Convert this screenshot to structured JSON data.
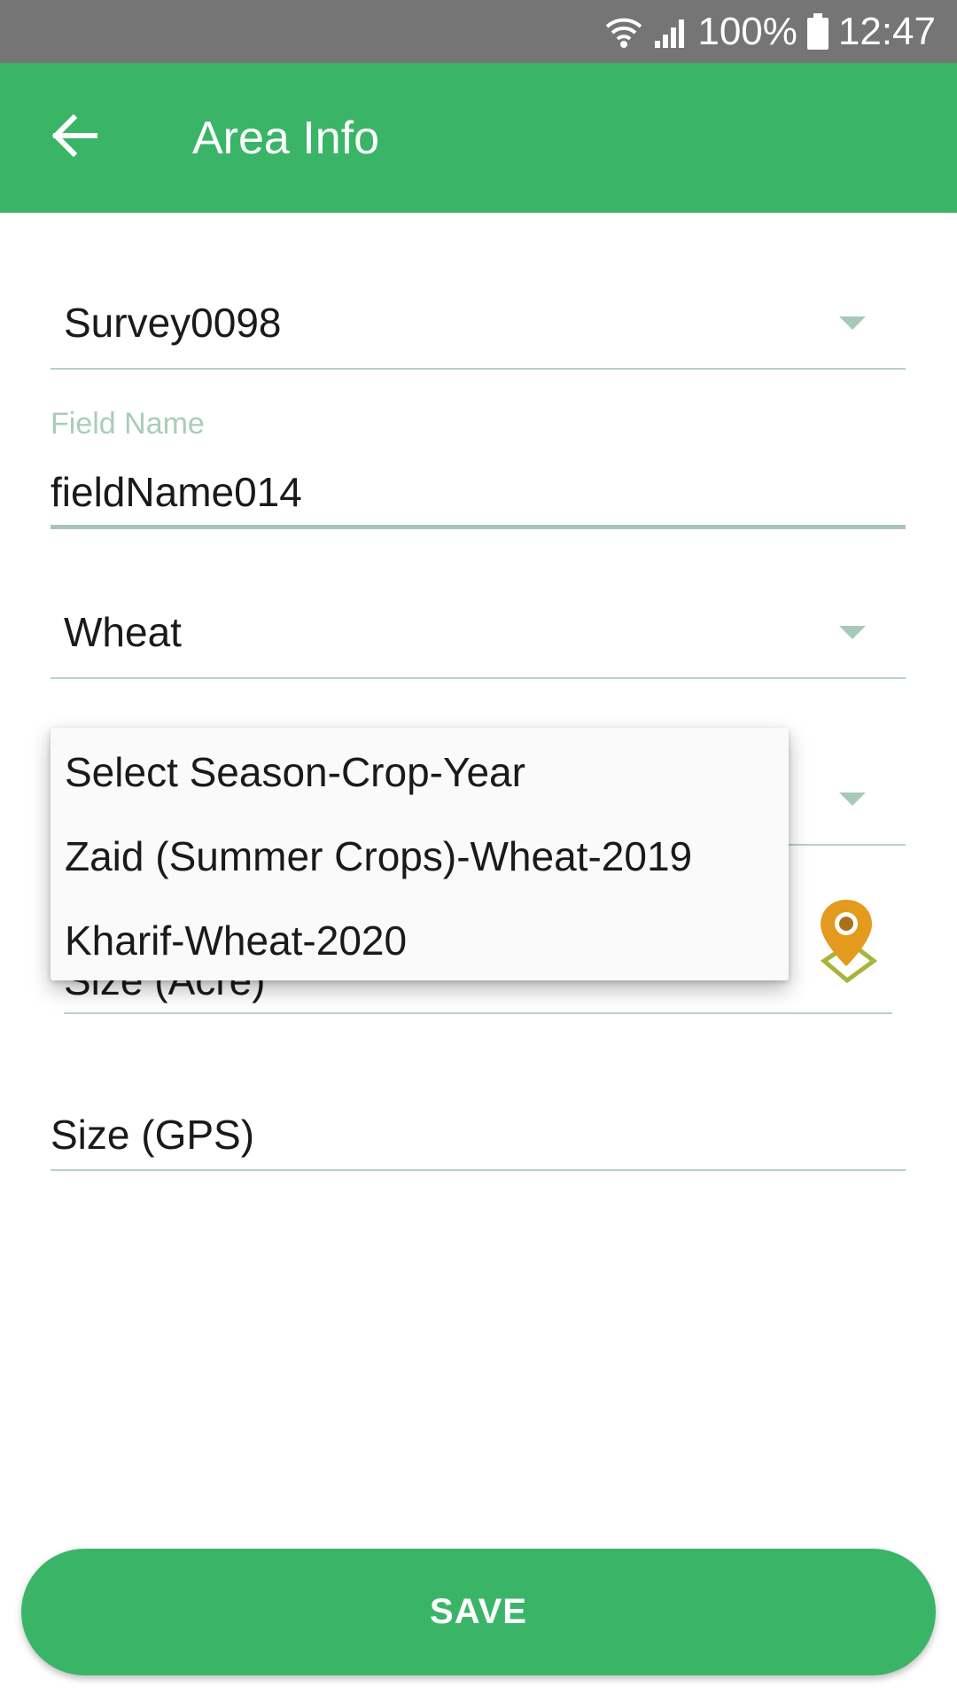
{
  "status_bar": {
    "battery": "100%",
    "time": "12:47"
  },
  "app_bar": {
    "title": "Area Info"
  },
  "form": {
    "survey_spinner": {
      "value": "Survey0098"
    },
    "field_name": {
      "label": "Field Name",
      "value": "fieldName014"
    },
    "crop_spinner": {
      "value": "Wheat"
    },
    "season_dropdown": {
      "options": [
        "Select Season-Crop-Year",
        "Zaid (Summer Crops)-Wheat-2019",
        "Kharif-Wheat-2020"
      ]
    },
    "size_acre": {
      "placeholder": "Size (Acre)"
    },
    "size_gps": {
      "placeholder": "Size (GPS)"
    }
  },
  "save_button": {
    "label": "SAVE"
  },
  "colors": {
    "primary": "#3ab567",
    "status_bar": "#757575",
    "pin": "#e39a1f"
  }
}
